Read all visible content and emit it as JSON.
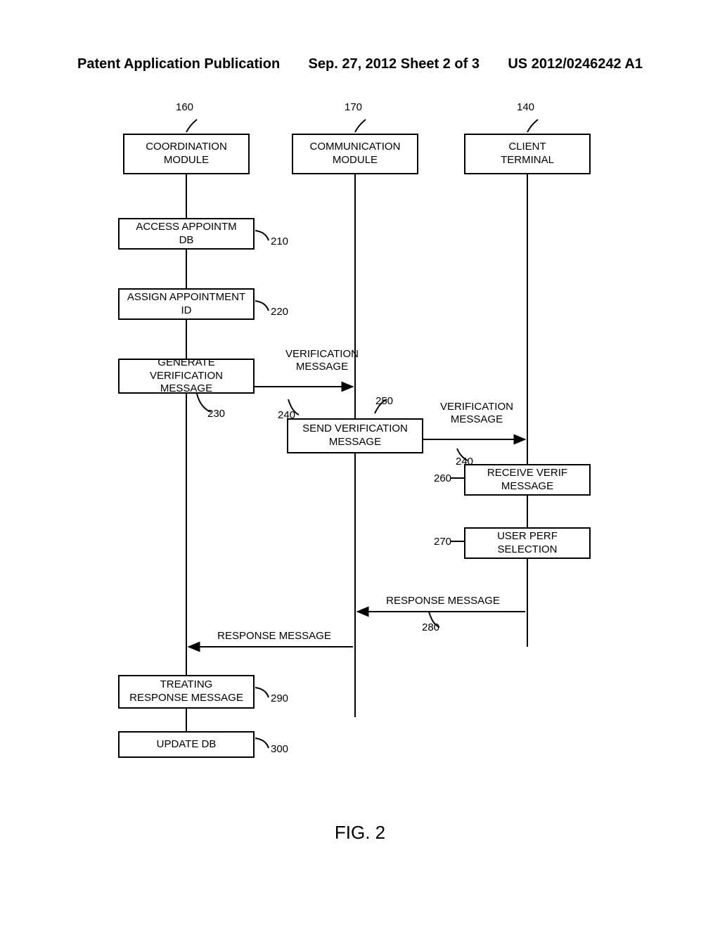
{
  "header": {
    "left": "Patent Application Publication",
    "center": "Sep. 27, 2012  Sheet 2 of 3",
    "right": "US 2012/0246242 A1"
  },
  "refs": {
    "r160": "160",
    "r170": "170",
    "r140": "140",
    "r210": "210",
    "r220": "220",
    "r230": "230",
    "r240a": "240",
    "r250": "250",
    "r240b": "240",
    "r260": "260",
    "r270": "270",
    "r280a": "280",
    "r280b": "280",
    "r290": "290",
    "r300": "300"
  },
  "boxes": {
    "coord": "COORDINATION\nMODULE",
    "comm": "COMMUNICATION\nMODULE",
    "client": "CLIENT\nTERMINAL",
    "access": "ACCESS APPOINTM\nDB",
    "assign": "ASSIGN APPOINTMENT\nID",
    "genverif": "GENERATE VERIFICATION\nMESSAGE",
    "sendverif": "SEND VERIFICATION\nMESSAGE",
    "recvverif": "RECEIVE VERIF\nMESSAGE",
    "userpref": "USER PERF\nSELECTION",
    "treating": "TREATING\nRESPONSE MESSAGE",
    "update": "UPDATE DB"
  },
  "arrows": {
    "verifmsg1": "VERIFICATION\nMESSAGE",
    "verifmsg2": "VERIFICATION\nMESSAGE",
    "respmsg": "RESPONSE MESSAGE",
    "respmsg2": "RESPONSE MESSAGE"
  },
  "figure_label": "FIG. 2",
  "chart_data": {
    "type": "sequence-diagram",
    "title": "FIG. 2",
    "lifelines": [
      {
        "id": "coord",
        "label": "COORDINATION MODULE",
        "ref": "160"
      },
      {
        "id": "comm",
        "label": "COMMUNICATION MODULE",
        "ref": "170"
      },
      {
        "id": "client",
        "label": "CLIENT TERMINAL",
        "ref": "140"
      }
    ],
    "steps": [
      {
        "ref": "210",
        "on": "coord",
        "label": "ACCESS APPOINTM DB"
      },
      {
        "ref": "220",
        "on": "coord",
        "label": "ASSIGN APPOINTMENT ID"
      },
      {
        "ref": "230",
        "on": "coord",
        "label": "GENERATE VERIFICATION MESSAGE"
      },
      {
        "ref": "240",
        "from": "coord",
        "to": "comm",
        "label": "VERIFICATION MESSAGE"
      },
      {
        "ref": "250",
        "on": "comm",
        "label": "SEND VERIFICATION MESSAGE"
      },
      {
        "ref": "240",
        "from": "comm",
        "to": "client",
        "label": "VERIFICATION MESSAGE"
      },
      {
        "ref": "260",
        "on": "client",
        "label": "RECEIVE VERIF MESSAGE"
      },
      {
        "ref": "270",
        "on": "client",
        "label": "USER PERF SELECTION"
      },
      {
        "ref": "280",
        "from": "client",
        "to": "comm",
        "label": "RESPONSE MESSAGE"
      },
      {
        "ref": "280",
        "from": "comm",
        "to": "coord",
        "label": "RESPONSE MESSAGE"
      },
      {
        "ref": "290",
        "on": "coord",
        "label": "TREATING RESPONSE MESSAGE"
      },
      {
        "ref": "300",
        "on": "coord",
        "label": "UPDATE DB"
      }
    ]
  }
}
